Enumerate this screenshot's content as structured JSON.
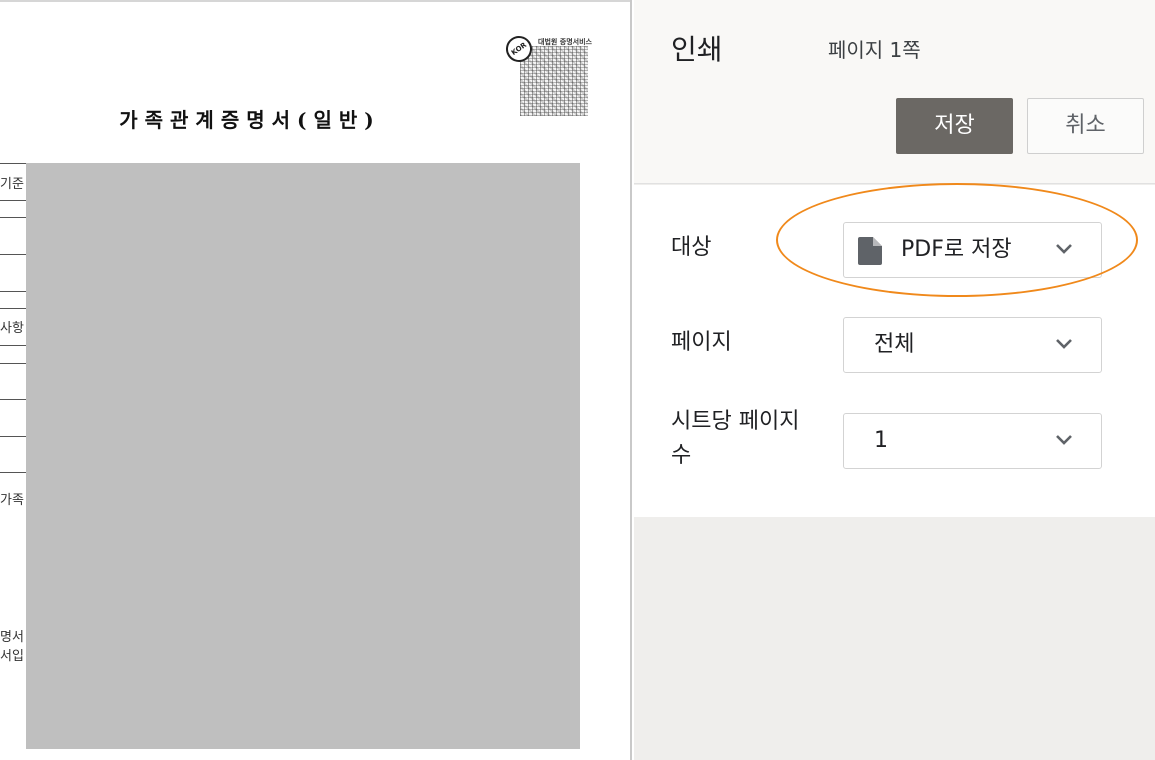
{
  "preview": {
    "doc_title": "가족관계증명서(일반)",
    "stamp_text": "대법원 증명서비스",
    "stamp_logo": "KOR",
    "side_labels": [
      "기준",
      "사항",
      "가족",
      "명서",
      "서입"
    ]
  },
  "panel": {
    "title": "인쇄",
    "page_count": "페이지 1쪽",
    "save_label": "저장",
    "cancel_label": "취소",
    "destination": {
      "label": "대상",
      "value": "PDF로 저장",
      "icon": "document-icon"
    },
    "pages": {
      "label": "페이지",
      "value": "전체"
    },
    "pages_per_sheet": {
      "label": "시트당 페이지 수",
      "value": "1"
    }
  },
  "colors": {
    "save_button": "#6b6864",
    "highlight": "#f0891b",
    "redaction": "#bfbfbf",
    "panel_background": "#efeeec"
  }
}
